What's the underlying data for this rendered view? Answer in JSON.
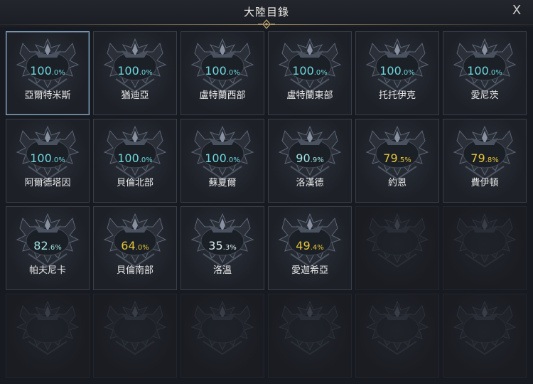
{
  "window": {
    "title": "大陸目錄",
    "close_label": "X"
  },
  "continents": [
    {
      "name": "亞爾特米斯",
      "pct_int": "100",
      "pct_dec": ".0%",
      "color": "full",
      "selected": true
    },
    {
      "name": "猶迪亞",
      "pct_int": "100",
      "pct_dec": ".0%",
      "color": "full"
    },
    {
      "name": "盧特蘭西部",
      "pct_int": "100",
      "pct_dec": ".0%",
      "color": "full"
    },
    {
      "name": "盧特蘭東部",
      "pct_int": "100",
      "pct_dec": ".0%",
      "color": "full"
    },
    {
      "name": "托托伊克",
      "pct_int": "100",
      "pct_dec": ".0%",
      "color": "full"
    },
    {
      "name": "愛尼茨",
      "pct_int": "100",
      "pct_dec": ".0%",
      "color": "full"
    },
    {
      "name": "阿爾德塔因",
      "pct_int": "100",
      "pct_dec": ".0%",
      "color": "full"
    },
    {
      "name": "貝倫北部",
      "pct_int": "100",
      "pct_dec": ".0%",
      "color": "full"
    },
    {
      "name": "蘇夏爾",
      "pct_int": "100",
      "pct_dec": ".0%",
      "color": "full"
    },
    {
      "name": "洛漢德",
      "pct_int": "90",
      "pct_dec": ".9%",
      "color": "mid"
    },
    {
      "name": "約恩",
      "pct_int": "79",
      "pct_dec": ".5%",
      "color": "low"
    },
    {
      "name": "費伊頓",
      "pct_int": "79",
      "pct_dec": ".8%",
      "color": "low"
    },
    {
      "name": "帕夫尼卡",
      "pct_int": "82",
      "pct_dec": ".6%",
      "color": "mid"
    },
    {
      "name": "貝倫南部",
      "pct_int": "64",
      "pct_dec": ".0%",
      "color": "low"
    },
    {
      "name": "洛溫",
      "pct_int": "35",
      "pct_dec": ".3%",
      "color": "pale"
    },
    {
      "name": "愛迦希亞",
      "pct_int": "49",
      "pct_dec": ".4%",
      "color": "low"
    }
  ],
  "empty_slots": 8
}
